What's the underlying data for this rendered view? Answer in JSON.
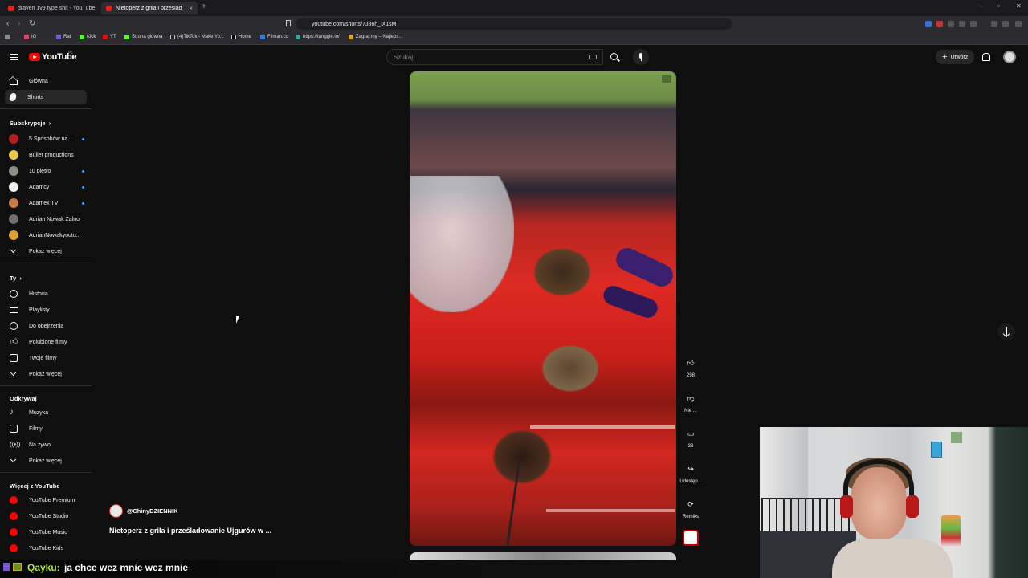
{
  "browser": {
    "tabs": [
      {
        "title": "draven 1v9 type shit - YouTube",
        "active": false
      },
      {
        "title": "Nietoperz z grila i prześladow",
        "active": true
      }
    ],
    "url": "youtube.com/shorts/7J86h_iX1sM",
    "bookmarks": [
      "IG",
      "Rat",
      "Kick",
      "YT",
      "Strona główna",
      "(4)TikTok - Make Yo...",
      "Home",
      "Filman.cc",
      "https://tanggle.io/",
      "Zagraj.my – Najleps..."
    ]
  },
  "youtube": {
    "logo_text": "YouTube",
    "region": "PL",
    "search_placeholder": "Szukaj",
    "create_label": "Utwórz"
  },
  "sidebar": {
    "main": [
      {
        "label": "Główna",
        "icon": "home-icon"
      },
      {
        "label": "Shorts",
        "icon": "shorts-icon",
        "active": true
      }
    ],
    "subscriptions_heading": "Subskrypcje",
    "subscriptions": [
      {
        "label": "5 Sposobów na...",
        "live": true
      },
      {
        "label": "Bullet productions",
        "live": false
      },
      {
        "label": "10 piętro",
        "live": true
      },
      {
        "label": "Adamcy",
        "live": true
      },
      {
        "label": "Adamek TV",
        "live": true
      },
      {
        "label": "Adrian Nowak Żalno",
        "live": false
      },
      {
        "label": "AdrianNowakyoutu...",
        "live": false
      }
    ],
    "show_more": "Pokaż więcej",
    "you_heading": "Ty",
    "you": [
      {
        "label": "Historia",
        "icon": "history-icon"
      },
      {
        "label": "Playlisty",
        "icon": "playlist-icon"
      },
      {
        "label": "Do obejrzenia",
        "icon": "clock-icon"
      },
      {
        "label": "Polubione filmy",
        "icon": "thumbs-up-icon"
      },
      {
        "label": "Twoje filmy",
        "icon": "video-icon"
      },
      {
        "label": "Pokaż więcej",
        "icon": "chevron-down-icon"
      }
    ],
    "explore_heading": "Odkrywaj",
    "explore": [
      {
        "label": "Muzyka",
        "icon": "music-icon"
      },
      {
        "label": "Filmy",
        "icon": "film-icon"
      },
      {
        "label": "Na żywo",
        "icon": "live-icon"
      },
      {
        "label": "Pokaż więcej",
        "icon": "chevron-down-icon"
      }
    ],
    "more_heading": "Więcej z YouTube",
    "more": [
      {
        "label": "YouTube Premium"
      },
      {
        "label": "YouTube Studio"
      },
      {
        "label": "YouTube Music"
      },
      {
        "label": "YouTube Kids"
      }
    ]
  },
  "short": {
    "channel": "@ChinyDZIENNIK",
    "title": "Nietoperz z grila i prześladowanie Ujgurów w ...",
    "actions": {
      "likes": "298",
      "dislike": "Nie ...",
      "comments": "33",
      "share": "Udostęp...",
      "remix": "Remiks"
    }
  },
  "chat": {
    "user": "Qayku:",
    "message": "ja chce wez mnie wez mnie"
  }
}
